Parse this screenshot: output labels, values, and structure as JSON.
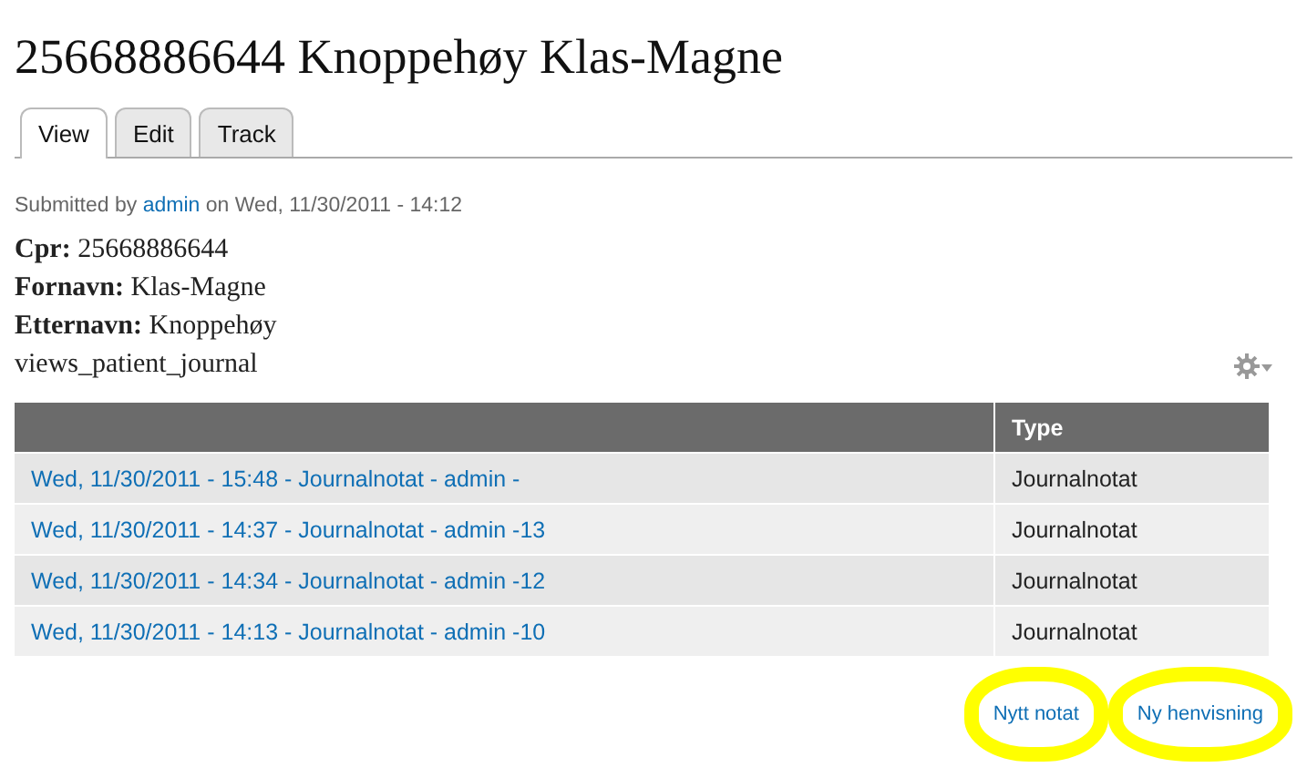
{
  "title": "25668886644 Knoppehøy Klas-Magne",
  "tabs": [
    {
      "label": "View",
      "selected": true
    },
    {
      "label": "Edit",
      "selected": false
    },
    {
      "label": "Track",
      "selected": false
    }
  ],
  "submitted": {
    "prefix": "Submitted by",
    "author": "admin",
    "suffix": "on Wed, 11/30/2011 - 14:12"
  },
  "fields": [
    {
      "label": "Cpr:",
      "value": "25668886644"
    },
    {
      "label": "Fornavn:",
      "value": "Klas-Magne"
    },
    {
      "label": "Etternavn:",
      "value": "Knoppehøy"
    }
  ],
  "view_name": "views_patient_journal",
  "table": {
    "columns": [
      "",
      "Type"
    ],
    "rows": [
      {
        "title": "Wed, 11/30/2011 - 15:48 - Journalnotat - admin -",
        "type": "Journalnotat"
      },
      {
        "title": "Wed, 11/30/2011 - 14:37 - Journalnotat - admin -13",
        "type": "Journalnotat"
      },
      {
        "title": "Wed, 11/30/2011 - 14:34 - Journalnotat - admin -12",
        "type": "Journalnotat"
      },
      {
        "title": "Wed, 11/30/2011 - 14:13 - Journalnotat - admin -10",
        "type": "Journalnotat"
      }
    ]
  },
  "actions": [
    {
      "label": "Nytt notat",
      "highlighted": true
    },
    {
      "label": "Ny henvisning",
      "highlighted": true
    }
  ]
}
